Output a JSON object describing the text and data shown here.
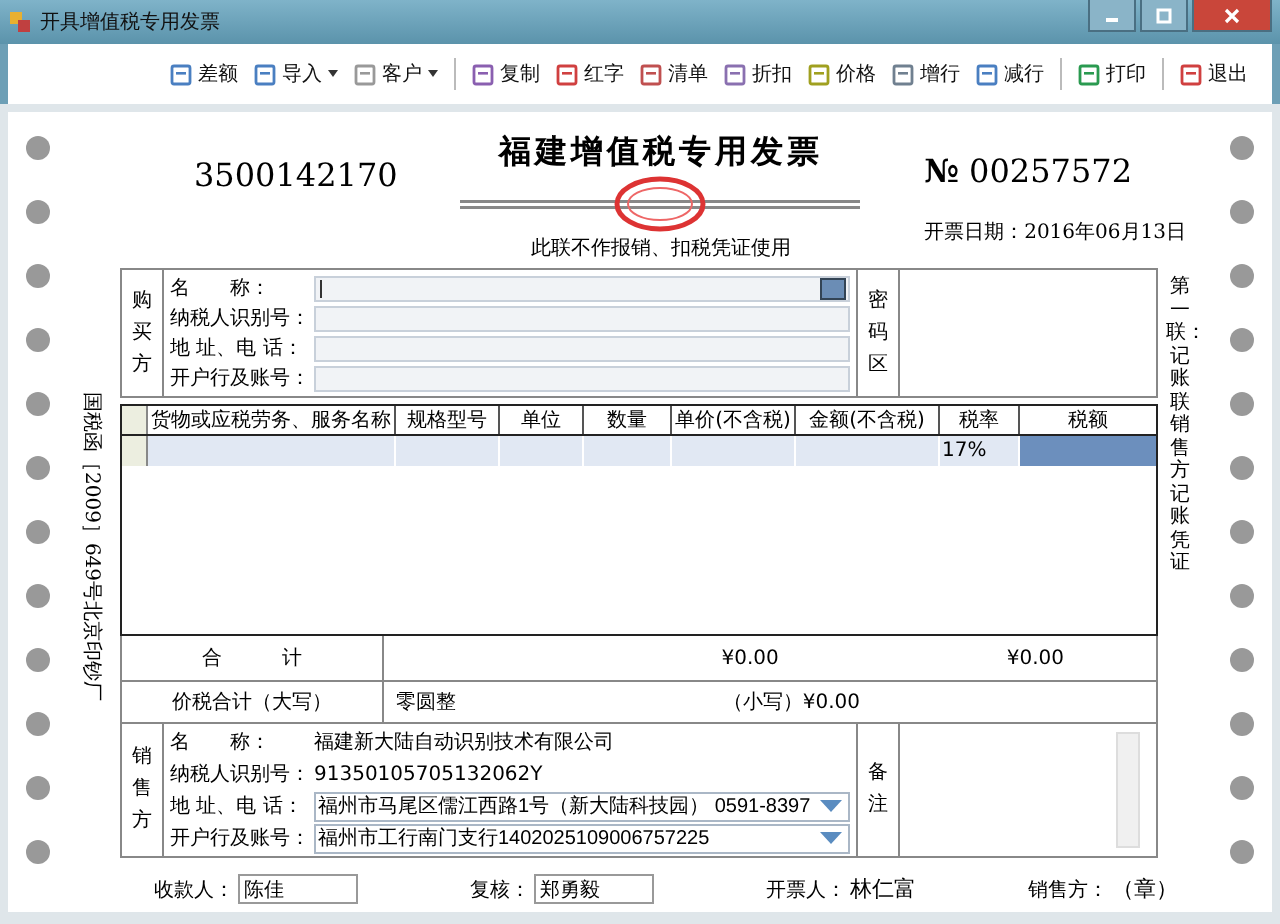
{
  "window": {
    "title": "开具增值税专用发票"
  },
  "toolbar": [
    {
      "label": "差额",
      "kind": "button",
      "separator_after": false
    },
    {
      "label": "导入",
      "kind": "dropdown",
      "separator_after": false
    },
    {
      "label": "客户",
      "kind": "dropdown",
      "separator_after": true
    },
    {
      "label": "复制",
      "kind": "button",
      "separator_after": false
    },
    {
      "label": "红字",
      "kind": "button",
      "separator_after": false
    },
    {
      "label": "清单",
      "kind": "button",
      "separator_after": false
    },
    {
      "label": "折扣",
      "kind": "button",
      "separator_after": false
    },
    {
      "label": "价格",
      "kind": "button",
      "separator_after": false
    },
    {
      "label": "增行",
      "kind": "button",
      "separator_after": false
    },
    {
      "label": "减行",
      "kind": "button",
      "separator_after": true
    },
    {
      "label": "打印",
      "kind": "button",
      "separator_after": true
    },
    {
      "label": "退出",
      "kind": "button",
      "separator_after": false
    }
  ],
  "invoice": {
    "code": "3500142170",
    "title": "福建增值税专用发票",
    "number_symbol": "№",
    "number": "00257572",
    "notice": "此联不作报销、扣税凭证使用",
    "date_label": "开票日期：",
    "date": "2016年06月13日",
    "side_left": "国税函［2009］649号北京印钞厂",
    "side_right": "第一联：记账联销售方记账凭证"
  },
  "buyer": {
    "side_label": "购买方",
    "password_label": "密码区",
    "fields": [
      {
        "label": "名　　称：",
        "kind": "lookup"
      },
      {
        "label": "纳税人识别号：",
        "kind": "input"
      },
      {
        "label": "地 址、电 话：",
        "kind": "input"
      },
      {
        "label": "开户行及账号：",
        "kind": "input"
      }
    ]
  },
  "table": {
    "columns": [
      "货物或应税劳务、服务名称",
      "规格型号",
      "单位",
      "数量",
      "单价(不含税)",
      "金额(不含税)",
      "税率",
      "税额"
    ],
    "rows": [
      {
        "cells": [
          {
            "selected": false
          },
          {
            "selected": false
          },
          {
            "selected": false
          },
          {
            "selected": false
          },
          {
            "selected": false
          },
          {
            "selected": false
          },
          {
            "text": "17%",
            "selected": false
          },
          {
            "selected": true
          }
        ]
      }
    ]
  },
  "totals": {
    "label": "合　　　计",
    "amount": "¥0.00",
    "tax": "¥0.00"
  },
  "grand_total": {
    "label": "价税合计（大写）",
    "words": "零圆整",
    "small_label": "（小写）",
    "small": "¥0.00"
  },
  "seller": {
    "side_label": "销售方",
    "remark_label": "备注",
    "fields": [
      {
        "label": "名　　称：",
        "value": "福建新大陆自动识别技术有限公司",
        "kind": "text"
      },
      {
        "label": "纳税人识别号：",
        "value": "91350105705132062Y",
        "kind": "text"
      },
      {
        "label": "地 址、电 话：",
        "value": "福州市马尾区儒江西路1号（新大陆科技园） 0591-8397",
        "kind": "dropdown"
      },
      {
        "label": "开户行及账号：",
        "value": "福州市工行南门支行1402025109006757225",
        "kind": "dropdown"
      }
    ]
  },
  "footer": [
    {
      "label": "收款人：",
      "value": "陈佳",
      "kind": "field"
    },
    {
      "label": "复核：",
      "value": "郑勇毅",
      "kind": "field"
    },
    {
      "label": "开票人：",
      "value": "林仁富",
      "kind": "text"
    },
    {
      "label": "销售方：",
      "value": "（章）",
      "kind": "text"
    }
  ]
}
